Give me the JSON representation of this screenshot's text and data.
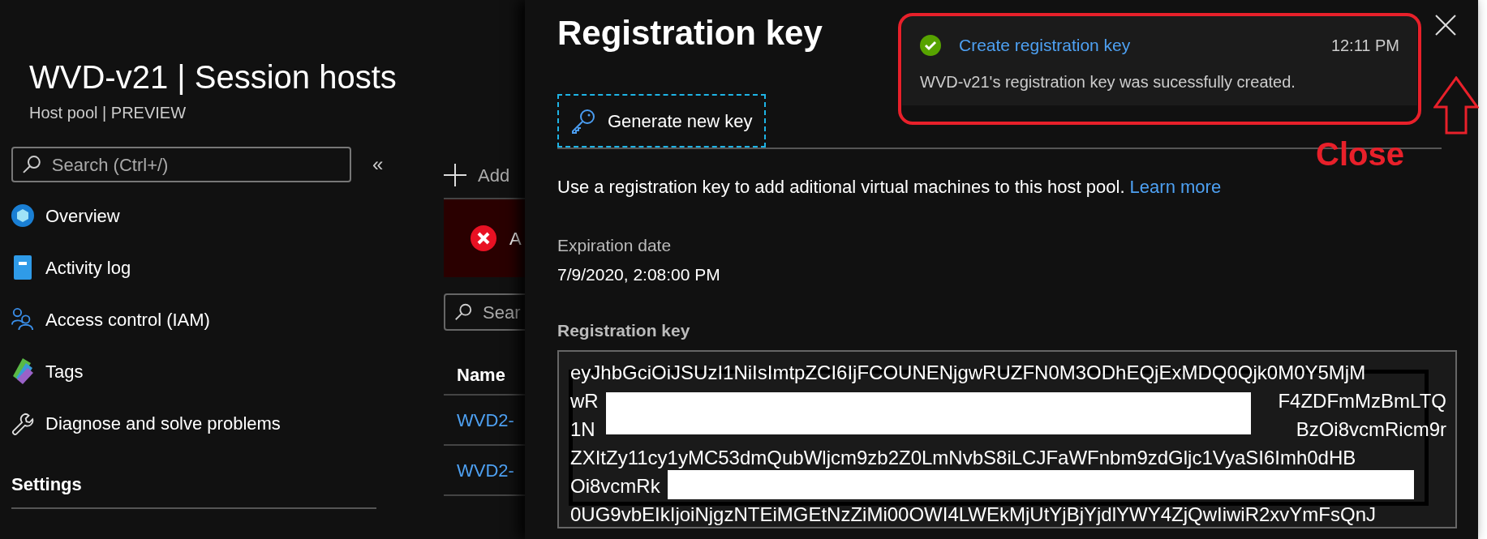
{
  "header": {
    "title": "WVD-v21 | Session hosts",
    "subtitle": "Host pool | PREVIEW"
  },
  "sidebar": {
    "search": {
      "placeholder": "Search (Ctrl+/)"
    },
    "collapse": "«",
    "items": [
      {
        "kind": "overview",
        "label": "Overview"
      },
      {
        "kind": "activity",
        "label": "Activity log"
      },
      {
        "kind": "iam",
        "label": "Access control (IAM)"
      },
      {
        "kind": "tags",
        "label": "Tags"
      },
      {
        "kind": "diagnose",
        "label": "Diagnose and solve problems"
      }
    ],
    "section": "Settings"
  },
  "content": {
    "add": "Add",
    "alert": "A",
    "search": {
      "placeholder": "Sear"
    },
    "column": "Name",
    "rows": [
      "WVD2-",
      "WVD2-"
    ]
  },
  "blade": {
    "title": "Registration key",
    "generate": "Generate new key",
    "description": "Use a registration key to add aditional virtual machines to this host pool.",
    "learn_more": "Learn more",
    "expiration_label": "Expiration date",
    "expiration_value": "7/9/2020, 2:08:00 PM",
    "key_label": "Registration key",
    "key_lines": [
      {
        "left": "eyJhbGciOiJSUzI1NiIsImtpZCI6IjFCOUNENjgwRUZFN0M3ODhEQjExMDQ0Qjk0M0Y5MjM"
      },
      {
        "left": "wR",
        "right": "F4ZDFmMzBmLTQ"
      },
      {
        "left": "1N",
        "right": "BzOi8vcmRicm9r"
      },
      {
        "left": "ZXItZy11cy1yMC53dmQubWljcm9zb2Z0LmNvbS8iLCJFaWFnbm9zdGljc1VyaSI6Imh0dHB"
      },
      {
        "left": "Oi8vcmRk"
      },
      {
        "left": "0UG9vbEIkIjoiNjgzNTEiMGEtNzZiMi00OWI4LWEkMjUtYjBjYjdlYWY4ZjQwIiwiR2xvYmFsQnJ"
      }
    ]
  },
  "notification": {
    "title": "Create registration key",
    "time": "12:11 PM",
    "message": "WVD-v21's registration key was sucessfully created."
  },
  "annotation": {
    "label": "Close"
  }
}
